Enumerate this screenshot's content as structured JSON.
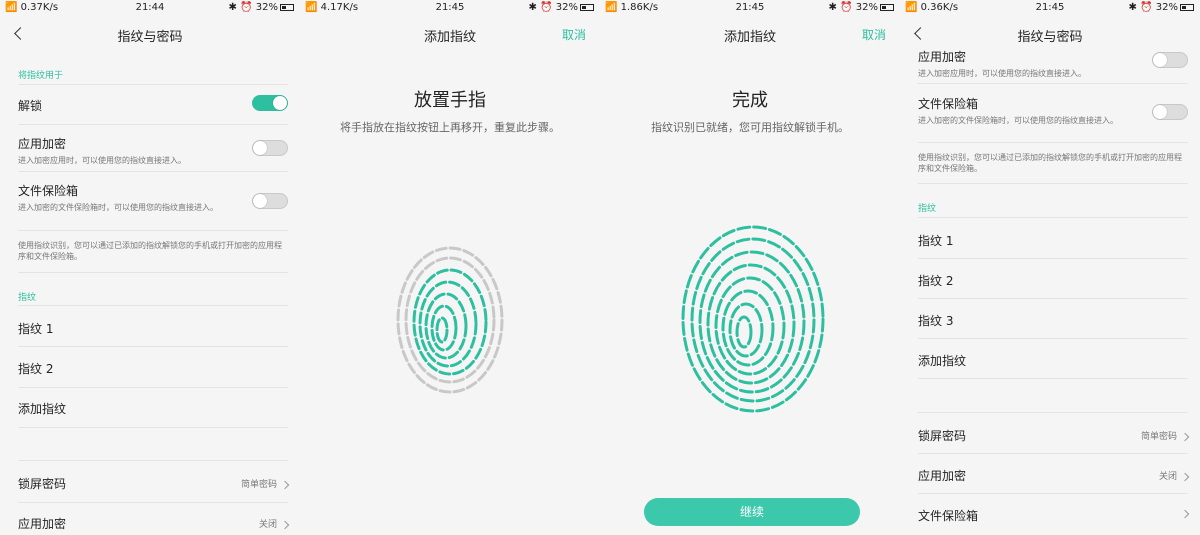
{
  "accent_color": "#2ebfa0",
  "screens": [
    {
      "status": {
        "speed": "0.37K/s",
        "time": "21:44",
        "battery": "32%"
      },
      "header": {
        "title": "指纹与密码"
      },
      "section_use": "将指纹用于",
      "unlock": {
        "label": "解锁",
        "on": true
      },
      "app_encrypt": {
        "label": "应用加密",
        "desc": "进入加密应用时，可以使用您的指纹直接进入。"
      },
      "file_safe": {
        "label": "文件保险箱",
        "desc": "进入加密的文件保险箱时，可以使用您的指纹直接进入。"
      },
      "note": "使用指纹识别，您可以通过已添加的指纹解锁您的手机或打开加密的应用程序和文件保险箱。",
      "section_fp": "指纹",
      "fingerprints": [
        "指纹 1",
        "指纹 2"
      ],
      "add_fp": "添加指纹",
      "lock_pw": {
        "label": "锁屏密码",
        "value": "简单密码"
      },
      "app_encrypt2": {
        "label": "应用加密",
        "value": "关闭"
      }
    },
    {
      "status": {
        "speed": "4.17K/s",
        "time": "21:45",
        "battery": "32%"
      },
      "header": {
        "title": "添加指纹",
        "cancel": "取消"
      },
      "title": "放置手指",
      "desc": "将手指放在指纹按钮上再移开，重复此步骤。"
    },
    {
      "status": {
        "speed": "1.86K/s",
        "time": "21:45",
        "battery": "32%"
      },
      "header": {
        "title": "添加指纹",
        "cancel": "取消"
      },
      "title": "完成",
      "desc": "指纹识别已就绪，您可用指纹解锁手机。",
      "continue_label": "继续"
    },
    {
      "status": {
        "speed": "0.36K/s",
        "time": "21:45",
        "battery": "32%"
      },
      "header": {
        "title": "指纹与密码"
      },
      "app_encrypt": {
        "label": "应用加密",
        "desc": "进入加密应用时，可以使用您的指纹直接进入。"
      },
      "file_safe": {
        "label": "文件保险箱",
        "desc": "进入加密的文件保险箱时，可以使用您的指纹直接进入。"
      },
      "note": "使用指纹识别，您可以通过已添加的指纹解锁您的手机或打开加密的应用程序和文件保险箱。",
      "section_fp": "指纹",
      "fingerprints": [
        "指纹 1",
        "指纹 2",
        "指纹 3"
      ],
      "add_fp": "添加指纹",
      "lock_pw": {
        "label": "锁屏密码",
        "value": "简单密码"
      },
      "app_encrypt2": {
        "label": "应用加密",
        "value": "关闭"
      },
      "file_safe2": {
        "label": "文件保险箱"
      }
    }
  ]
}
